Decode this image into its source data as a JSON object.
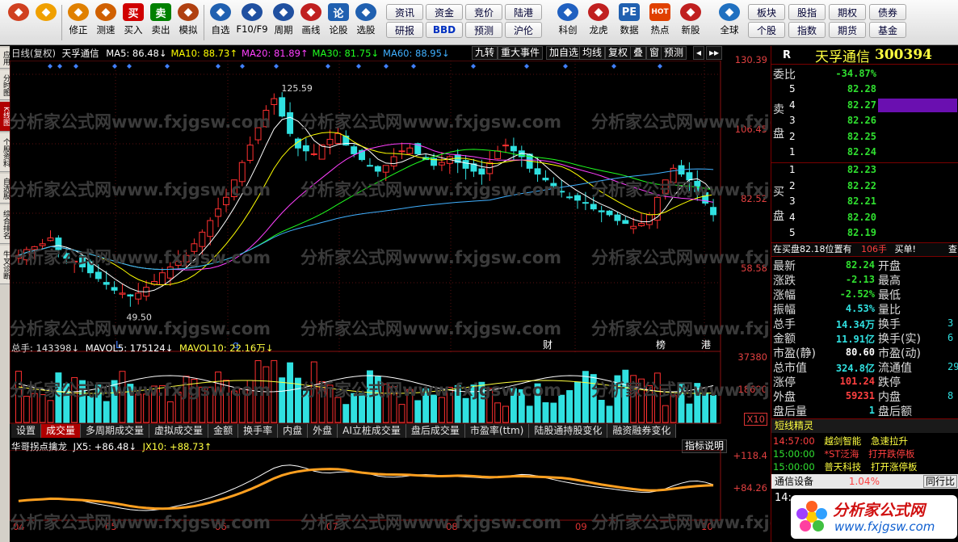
{
  "toolbar": {
    "buttons": [
      {
        "label": "",
        "icon": "grid-icon",
        "color": "#d04020"
      },
      {
        "label": "",
        "icon": "back-arrow-icon",
        "color": "#f0a000"
      },
      {
        "label": "修正",
        "icon": "fix-icon",
        "color": "#e08000"
      },
      {
        "label": "测速",
        "icon": "clock-icon",
        "color": "#d06000"
      },
      {
        "label": "买入",
        "icon": "buy-icon",
        "color": "#d00000",
        "glyph": "买"
      },
      {
        "label": "卖出",
        "icon": "sell-icon",
        "color": "#008000",
        "glyph": "卖"
      },
      {
        "label": "模拟",
        "icon": "hammer-icon",
        "color": "#b04010"
      },
      {
        "label": "自选",
        "icon": "watchlist-icon",
        "color": "#2060b0"
      },
      {
        "label": "F10/F9",
        "icon": "f10-icon",
        "color": "#2050a0"
      },
      {
        "label": "周期",
        "icon": "period-icon",
        "color": "#2050a0"
      },
      {
        "label": "画线",
        "icon": "pen-icon",
        "color": "#c02020"
      },
      {
        "label": "论股",
        "icon": "discuss-icon",
        "color": "#2060b0",
        "glyph": "论"
      },
      {
        "label": "选股",
        "icon": "select-icon",
        "color": "#2060b0"
      }
    ],
    "grid1": [
      [
        "资讯",
        "资金",
        "竞价",
        "陆港"
      ],
      [
        "研报",
        "BBD",
        "预测",
        "沪伦"
      ]
    ],
    "buttons2": [
      {
        "label": "科创",
        "icon": "rocket-icon",
        "color": "#2060c0"
      },
      {
        "label": "龙虎",
        "icon": "dragon-icon",
        "color": "#c02020"
      },
      {
        "label": "数据",
        "icon": "pe-icon",
        "color": "#2060b0",
        "glyph": "PE"
      },
      {
        "label": "热点",
        "icon": "hot-icon",
        "color": "#e04000",
        "glyph": "HOT"
      },
      {
        "label": "新股",
        "icon": "ipo-icon",
        "color": "#c02020"
      },
      {
        "label": "全球",
        "icon": "globe-icon",
        "color": "#2070c0"
      }
    ],
    "grid2": [
      [
        "板块",
        "股指",
        "期权",
        "债券"
      ],
      [
        "个股",
        "指数",
        "期货",
        "基金"
      ]
    ]
  },
  "leftstrip": [
    "应用",
    "分时图",
    "K线图",
    "个股资料",
    "自选股",
    "综合排名",
    "牛叉诊断"
  ],
  "kline": {
    "title": "日线(复权)",
    "name": "天孚通信",
    "ma": [
      {
        "label": "MA5: 86.48↓",
        "color": "#ffffff"
      },
      {
        "label": "MA10: 88.73↑",
        "color": "#ffff00"
      },
      {
        "label": "MA20: 81.89↑",
        "color": "#ff40ff"
      },
      {
        "label": "MA30: 81.75↓",
        "color": "#20ff20"
      },
      {
        "label": "MA60: 88.95↓",
        "color": "#40b0ff"
      }
    ],
    "btns": [
      "九转",
      "重大事件",
      "加自选",
      "均线",
      "复权",
      "叠",
      "窗",
      "预测"
    ],
    "axis": [
      "130.39",
      "106.45",
      "82.52",
      "58.58"
    ],
    "high_label": "125.59",
    "low_label": "49.50",
    "markers": [
      "L",
      "q",
      "财",
      "榜",
      "港"
    ]
  },
  "volume": {
    "title": "总手: 143398↓",
    "mavol5": "MAVOL5: 175124↓",
    "mavol10": "MAVOL10: 22.16万↓",
    "axis": [
      "37380",
      "18690"
    ],
    "unit": "X10"
  },
  "tabs": [
    "设置",
    "成交量",
    "多周期成交量",
    "虚拟成交量",
    "金额",
    "换手率",
    "内盘",
    "外盘",
    "AI立桩成交量",
    "盘后成交量",
    "市盈率(ttm)",
    "陆股通持股变化",
    "融资融券变化"
  ],
  "indicator": {
    "title": "华哥拐点擒龙",
    "jx5": "JX5: +86.48↓",
    "jx10": "JX10: +88.73↑",
    "explain": "指标说明",
    "axis": [
      "+118.4",
      "+84.26"
    ]
  },
  "xlabels": [
    "04",
    "05",
    "06",
    "07",
    "08",
    "09",
    "10"
  ],
  "watermark": "分析家公式网www.fxjgsw.com",
  "quote": {
    "r": "R",
    "name": "天孚通信",
    "code": "300394",
    "webi_label": "委比",
    "webi": "-34.87%",
    "sell_label": "卖盘",
    "buy_label": "买盘",
    "sell": [
      {
        "n": "5",
        "p": "82.28"
      },
      {
        "n": "4",
        "p": "82.27"
      },
      {
        "n": "3",
        "p": "82.26"
      },
      {
        "n": "2",
        "p": "82.25"
      },
      {
        "n": "1",
        "p": "82.24"
      }
    ],
    "buy": [
      {
        "n": "1",
        "p": "82.23"
      },
      {
        "n": "2",
        "p": "82.22"
      },
      {
        "n": "3",
        "p": "82.21"
      },
      {
        "n": "4",
        "p": "82.20"
      },
      {
        "n": "5",
        "p": "82.19"
      }
    ],
    "note": "在买盘82.18位置有",
    "note_qty": "106手",
    "note_tag": "买单!",
    "note_more": "查",
    "stats": [
      {
        "l": "最新",
        "v": "82.24",
        "c": "grn",
        "l2": "开盘"
      },
      {
        "l": "涨跌",
        "v": "-2.13",
        "c": "grn",
        "l2": "最高"
      },
      {
        "l": "涨幅",
        "v": "-2.52%",
        "c": "grn",
        "l2": "最低"
      },
      {
        "l": "振幅",
        "v": "4.53%",
        "c": "cyan",
        "l2": "量比"
      },
      {
        "l": "总手",
        "v": "14.34万",
        "c": "cyan",
        "l2": "换手",
        "v2": "3"
      },
      {
        "l": "金额",
        "v": "11.91亿",
        "c": "cyan",
        "l2": "换手(实)",
        "v2": "6"
      },
      {
        "l": "市盈(静)",
        "v": "80.60",
        "c": "wht",
        "l2": "市盈(动)"
      },
      {
        "l": "总市值",
        "v": "324.8亿",
        "c": "cyan",
        "l2": "流通值",
        "v2": "29"
      },
      {
        "l": "涨停",
        "v": "101.24",
        "c": "red",
        "l2": "跌停"
      },
      {
        "l": "外盘",
        "v": "59231",
        "c": "red",
        "l2": "内盘",
        "v2": "8"
      },
      {
        "l": "盘后量",
        "v": "1",
        "c": "cyan",
        "l2": "盘后额"
      }
    ],
    "sprite_title": "短线精灵",
    "sprites": [
      {
        "t": "14:57:00",
        "s": "越剑智能",
        "e": "急速拉升"
      },
      {
        "t": "15:00:00",
        "s": "*ST泛海",
        "e": "打开跌停板"
      },
      {
        "t": "15:00:00",
        "s": "普天科技",
        "e": "打开涨停板"
      }
    ],
    "sector": "通信设备",
    "sector_pct": "1.04%",
    "sector_more": "同行比",
    "bottom_time": "14:"
  },
  "chart_data": {
    "type": "candlestick",
    "title": "日线(复权)",
    "price_axis": [
      58.58,
      82.52,
      106.45,
      130.39
    ],
    "candles_close_approx": [
      68,
      70,
      71,
      72,
      74,
      70,
      67,
      66,
      64,
      62,
      60,
      58,
      56,
      55,
      54,
      55,
      57,
      59,
      62,
      64,
      66,
      68,
      72,
      76,
      80,
      84,
      88,
      94,
      100,
      106,
      112,
      118,
      122,
      116,
      110,
      105,
      104,
      103,
      106,
      108,
      110,
      106,
      103,
      101,
      99,
      97,
      99,
      102,
      104,
      105,
      103,
      101,
      99,
      100,
      102,
      100,
      98,
      97,
      96,
      100,
      104,
      106,
      104,
      102,
      98,
      96,
      94,
      92,
      90,
      88,
      87,
      86,
      84,
      83,
      82,
      80,
      79,
      78,
      79,
      82,
      88,
      94,
      98,
      96,
      94,
      90,
      86,
      82
    ]
  }
}
